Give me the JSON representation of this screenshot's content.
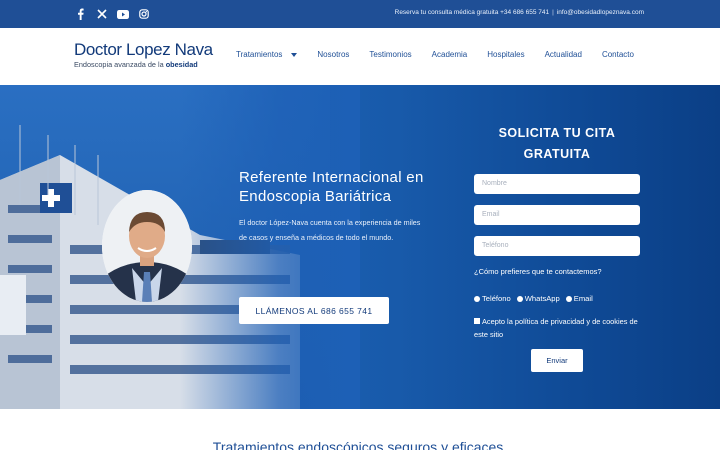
{
  "topbar": {
    "social": [
      "facebook-icon",
      "x-icon",
      "youtube-icon",
      "instagram-icon"
    ],
    "consult_text": "Reserva tu consulta médica gratuita +34 686 655 741",
    "separator": "|",
    "email": "info@obesidadlopeznava.com"
  },
  "logo": {
    "title_part1": "Doctor ",
    "title_part2": "Lopez Nava",
    "subtitle": "Endoscopia avanzada de la ",
    "subtitle_bold": "obesidad"
  },
  "nav": {
    "items": [
      "Tratamientos",
      "Nosotros",
      "Testimonios",
      "Academia",
      "Hospitales",
      "Actualidad",
      "Contacto"
    ]
  },
  "hero": {
    "title": "Referente Internacional en Endoscopia Bariátrica",
    "text": "El doctor López-Nava cuenta con la experiencia de miles de casos y enseña a médicos de todo el mundo.",
    "call_button": "LLÁMENOS AL 686 655 741"
  },
  "form": {
    "title": "SOLICITA TU CITA GRATUITA",
    "name_placeholder": "Nombre",
    "email_placeholder": "Email",
    "phone_placeholder": "Teléfono",
    "contact_question": "¿Cómo prefieres que te contactemos?",
    "options": [
      "Teléfono",
      "WhatsApp",
      "Email"
    ],
    "privacy": "Acepto la política de privacidad y de cookies de este sitio",
    "submit": "Enviar"
  },
  "section": {
    "title": "Tratamientos endoscópicos seguros y eficaces."
  },
  "colors": {
    "brand_blue": "#1f4f96",
    "hero_blue": "#1d5fb5",
    "dark_navy": "#123a7a"
  }
}
